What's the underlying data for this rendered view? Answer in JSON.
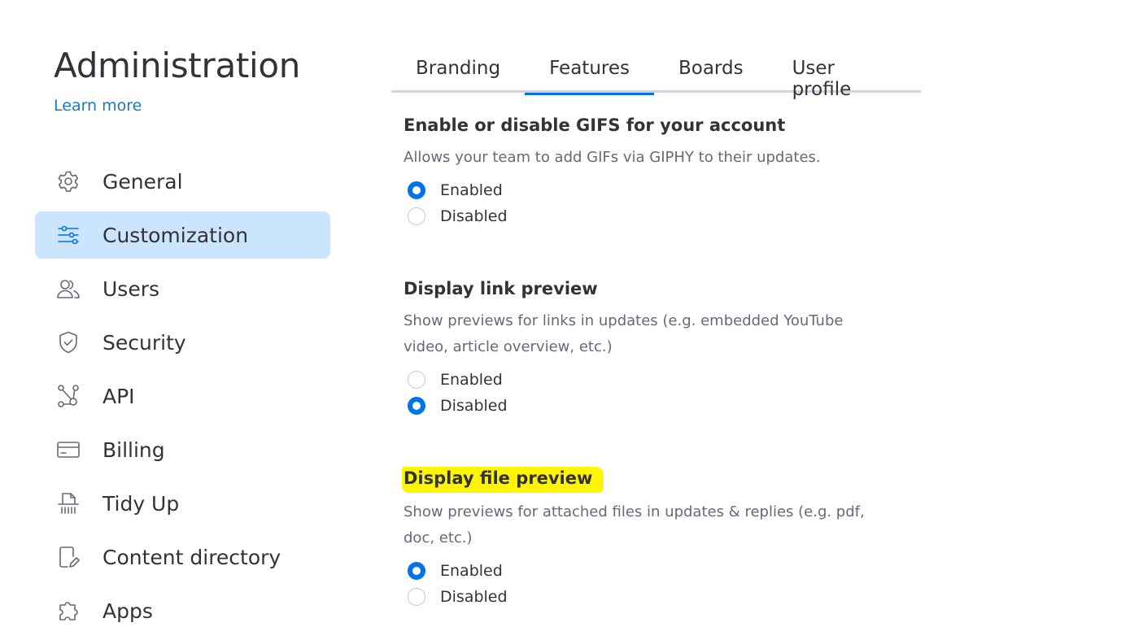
{
  "header": {
    "title": "Administration",
    "learn_more": "Learn more"
  },
  "sidebar": {
    "items": [
      {
        "label": "General",
        "icon": "gear-icon"
      },
      {
        "label": "Customization",
        "icon": "sliders-icon",
        "active": true
      },
      {
        "label": "Users",
        "icon": "users-icon"
      },
      {
        "label": "Security",
        "icon": "shield-check-icon"
      },
      {
        "label": "API",
        "icon": "api-nodes-icon"
      },
      {
        "label": "Billing",
        "icon": "credit-card-icon"
      },
      {
        "label": "Tidy Up",
        "icon": "shredder-icon"
      },
      {
        "label": "Content directory",
        "icon": "document-edit-icon"
      },
      {
        "label": "Apps",
        "icon": "puzzle-icon"
      }
    ]
  },
  "tabs": [
    {
      "label": "Branding"
    },
    {
      "label": "Features",
      "active": true
    },
    {
      "label": "Boards"
    },
    {
      "label": "User profile"
    }
  ],
  "sections": [
    {
      "title": "Enable or disable GIFS for your account",
      "description": "Allows your team to add GIFs via GIPHY to their updates.",
      "options": [
        {
          "label": "Enabled",
          "checked": true
        },
        {
          "label": "Disabled",
          "checked": false
        }
      ]
    },
    {
      "title": "Display link preview",
      "description": "Show previews for links in updates (e.g. embedded YouTube video, article overview, etc.)",
      "options": [
        {
          "label": "Enabled",
          "checked": false
        },
        {
          "label": "Disabled",
          "checked": true
        }
      ]
    },
    {
      "title": "Display file preview",
      "highlighted": true,
      "description": "Show previews for attached files in updates & replies (e.g. pdf, doc, etc.)",
      "options": [
        {
          "label": "Enabled",
          "checked": true
        },
        {
          "label": "Disabled",
          "checked": false
        }
      ]
    }
  ],
  "colors": {
    "accent": "#0073ea",
    "active_nav_bg": "#cce5ff",
    "link": "#1f76c2",
    "highlight": "#fff500"
  }
}
